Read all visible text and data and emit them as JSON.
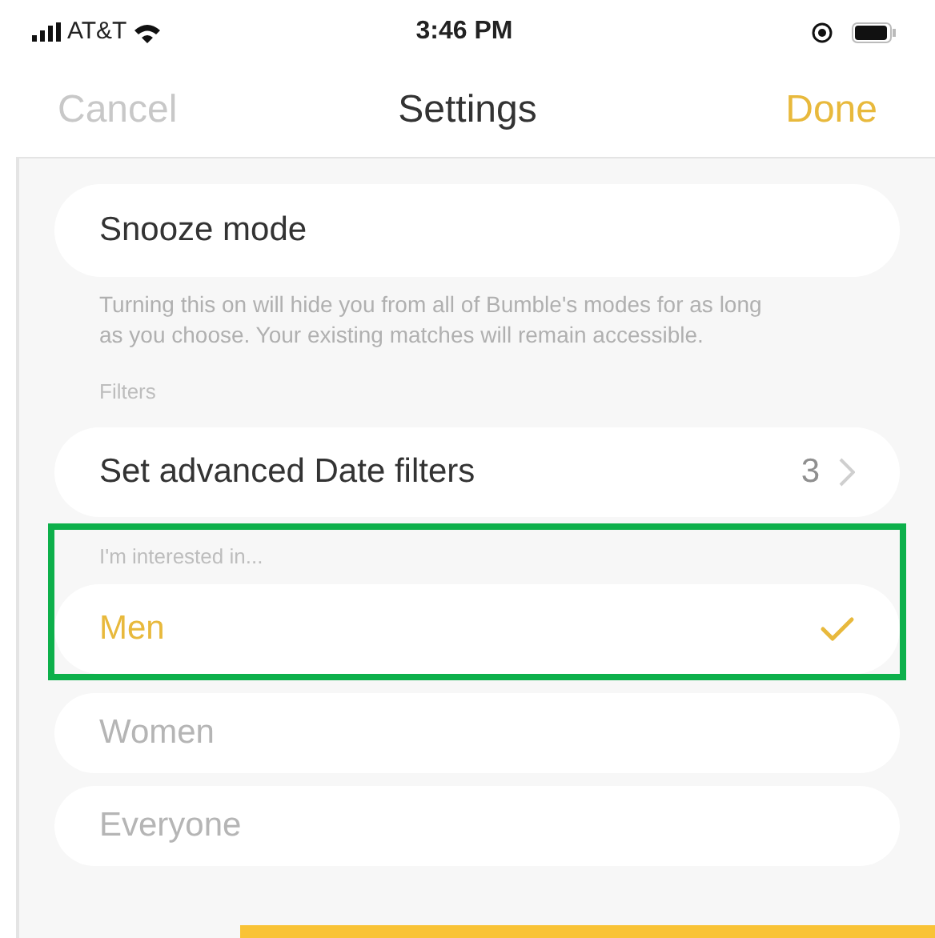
{
  "status_bar": {
    "carrier": "AT&T",
    "time": "3:46 PM"
  },
  "nav": {
    "cancel": "Cancel",
    "title": "Settings",
    "done": "Done"
  },
  "snooze": {
    "label": "Snooze mode",
    "description": "Turning this on will hide you from all of Bumble's modes for as long as you choose. Your existing matches will remain accessible."
  },
  "filters": {
    "header": "Filters",
    "advanced": {
      "label": "Set advanced Date filters",
      "count": "3"
    }
  },
  "interest": {
    "header": "I'm interested in...",
    "options": [
      {
        "label": "Men",
        "selected": true
      },
      {
        "label": "Women",
        "selected": false
      },
      {
        "label": "Everyone",
        "selected": false
      }
    ]
  }
}
